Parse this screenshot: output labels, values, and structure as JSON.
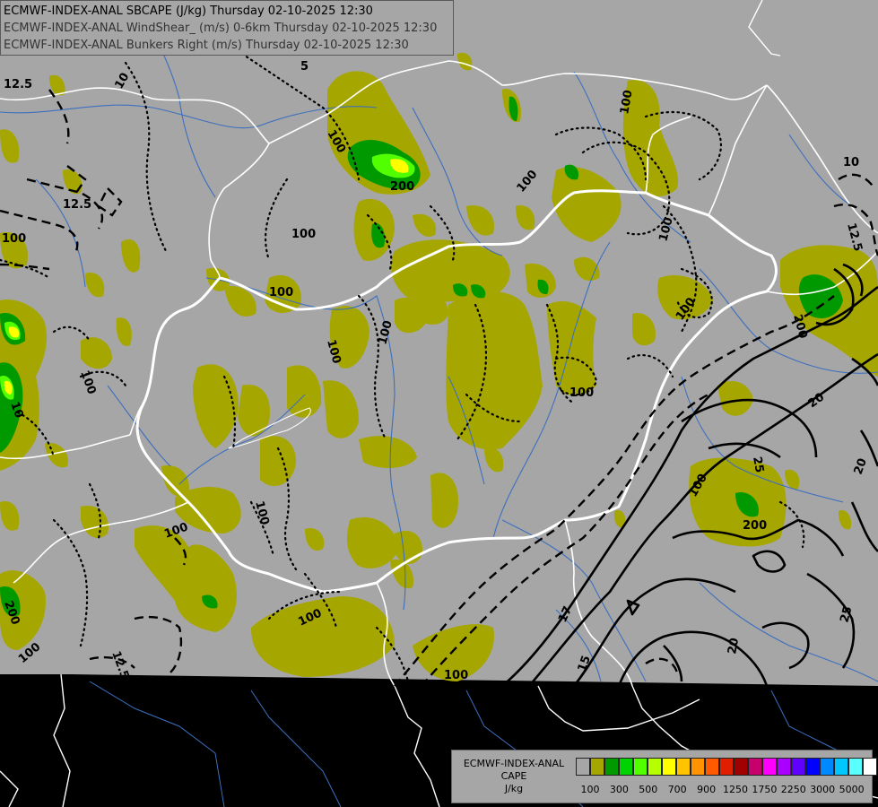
{
  "header": {
    "line1": "ECMWF-INDEX-ANAL SBCAPE (J/kg) Thursday 02-10-2025 12:30",
    "line2": "ECMWF-INDEX-ANAL WindShear_ (m/s) 0-6km Thursday 02-10-2025 12:30",
    "line3": "ECMWF-INDEX-ANAL Bunkers Right (m/s) Thursday 02-10-2025 12:30"
  },
  "legend": {
    "title1": "ECMWF-INDEX-ANAL",
    "title2": "CAPE",
    "unit": "J/kg",
    "swatches": [
      "#a6a6a6",
      "#a6a600",
      "#009a00",
      "#00d400",
      "#52ff00",
      "#b6ff00",
      "#ffff00",
      "#ffc300",
      "#ff9400",
      "#ff5a00",
      "#e01e00",
      "#a00000",
      "#c8006e",
      "#ff00ff",
      "#aa00ff",
      "#6000ff",
      "#0000ff",
      "#0088ff",
      "#00c8ff",
      "#5affff",
      "#ffffff"
    ],
    "labels": [
      "100",
      "300",
      "500",
      "700",
      "900",
      "1250",
      "1750",
      "2250",
      "3000",
      "5000"
    ]
  },
  "colors": {
    "no_data": "#000000",
    "base": "#a6a6a6",
    "cape_100": "#a6a600",
    "cape_300": "#009a00",
    "cape_500": "#00d400",
    "cape_700": "#52ff00",
    "cape_900": "#b6ff00",
    "border": "#ffffff",
    "river": "#3d6fbf"
  },
  "contour_labels": {
    "shear": [
      "12.5",
      "10",
      "5",
      "12.5",
      "10",
      "12.5",
      "20",
      "25",
      "20",
      "17",
      "15",
      "20",
      "25",
      "12.5"
    ],
    "cape": [
      "100",
      "100",
      "100",
      "100",
      "100",
      "100",
      "100",
      "100",
      "100",
      "100",
      "100",
      "100",
      "100",
      "100",
      "100",
      "100",
      "100",
      "100",
      "200",
      "200",
      "200",
      "200",
      "10"
    ]
  }
}
